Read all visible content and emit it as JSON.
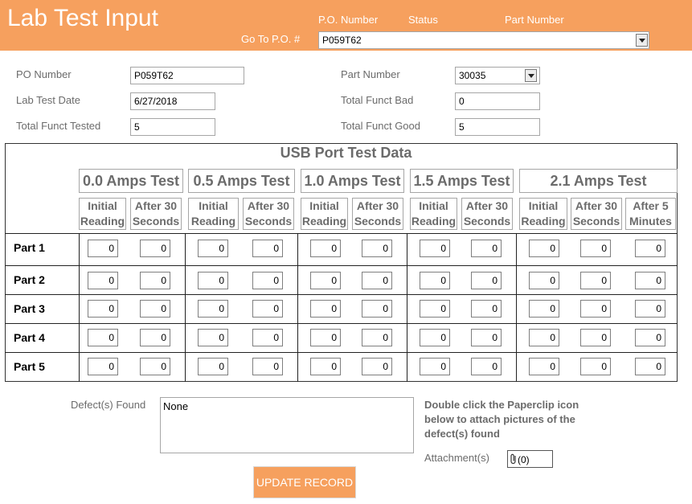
{
  "header": {
    "title": "Lab Test Input",
    "col_po": "P.O. Number",
    "col_status": "Status",
    "col_part": "Part Number",
    "goto_label": "Go To P.O. #",
    "goto_value": "P059T62"
  },
  "form": {
    "po_number_label": "PO Number",
    "po_number_value": "P059T62",
    "lab_test_date_label": "Lab Test Date",
    "lab_test_date_value": "6/27/2018",
    "total_funct_tested_label": "Total Funct Tested",
    "total_funct_tested_value": "5",
    "part_number_label": "Part Number",
    "part_number_value": "30035",
    "total_funct_bad_label": "Total Funct Bad",
    "total_funct_bad_value": "0",
    "total_funct_good_label": "Total Funct Good",
    "total_funct_good_value": "5"
  },
  "grid": {
    "title": "USB Port Test Data",
    "tests": [
      {
        "label": "0.0 Amps Test",
        "sub": [
          "Initial\nReading",
          "After 30\nSeconds"
        ]
      },
      {
        "label": "0.5 Amps Test",
        "sub": [
          "Initial\nReading",
          "After 30\nSeconds"
        ]
      },
      {
        "label": "1.0 Amps Test",
        "sub": [
          "Initial\nReading",
          "After 30\nSeconds"
        ]
      },
      {
        "label": "1.5 Amps Test",
        "sub": [
          "Initial\nReading",
          "After 30\nSeconds"
        ]
      },
      {
        "label": "2.1 Amps Test",
        "sub": [
          "Initial\nReading",
          "After 30\nSeconds",
          "After 5\nMinutes"
        ]
      }
    ],
    "rows": [
      {
        "label": "Part 1",
        "values": [
          "0",
          "0",
          "0",
          "0",
          "0",
          "0",
          "0",
          "0",
          "0",
          "0",
          "0"
        ]
      },
      {
        "label": "Part 2",
        "values": [
          "0",
          "0",
          "0",
          "0",
          "0",
          "0",
          "0",
          "0",
          "0",
          "0",
          "0"
        ]
      },
      {
        "label": "Part 3",
        "values": [
          "0",
          "0",
          "0",
          "0",
          "0",
          "0",
          "0",
          "0",
          "0",
          "0",
          "0"
        ]
      },
      {
        "label": "Part 4",
        "values": [
          "0",
          "0",
          "0",
          "0",
          "0",
          "0",
          "0",
          "0",
          "0",
          "0",
          "0"
        ]
      },
      {
        "label": "Part 5",
        "values": [
          "0",
          "0",
          "0",
          "0",
          "0",
          "0",
          "0",
          "0",
          "0",
          "0",
          "0"
        ]
      }
    ]
  },
  "bottom": {
    "defects_label": "Defect(s) Found",
    "defects_value": "None",
    "instructions": "Double click the Paperclip icon below to attach pictures of the defect(s) found",
    "attachments_label": "Attachment(s)",
    "attachments_count": "(0)",
    "update_button": "UPDATE RECORD"
  },
  "colors": {
    "accent": "#f6a05e",
    "label": "#6b6b6b"
  }
}
